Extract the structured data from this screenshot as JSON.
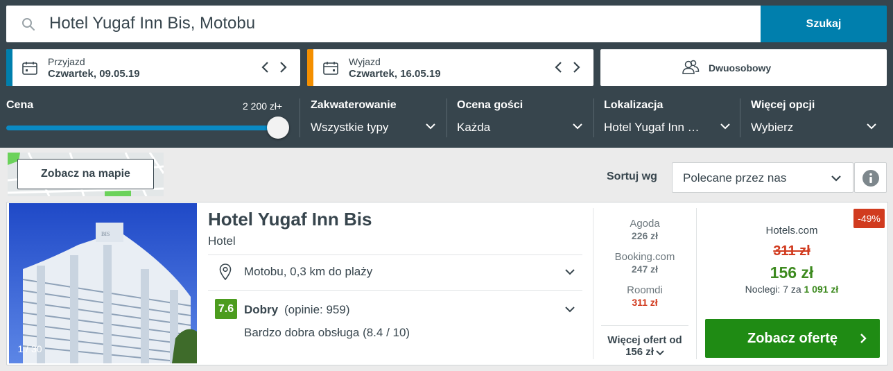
{
  "search": {
    "query": "Hotel Yugaf Inn Bis, Motobu",
    "button": "Szukaj"
  },
  "checkin": {
    "label": "Przyjazd",
    "value": "Czwartek, 09.05.19",
    "accent": "#007fad"
  },
  "checkout": {
    "label": "Wyjazd",
    "value": "Czwartek, 16.05.19",
    "accent": "#f48f00"
  },
  "room": {
    "label": "Dwuosobowy",
    "icon": "guests-icon"
  },
  "filters": {
    "price": {
      "title": "Cena",
      "max_label": "2 200 zł+",
      "slider_fraction": 1.0
    },
    "accommodation": {
      "title": "Zakwaterowanie",
      "value": "Wszystkie typy"
    },
    "rating": {
      "title": "Ocena gości",
      "value": "Każda"
    },
    "location": {
      "title": "Lokalizacja",
      "value": "Hotel Yugaf Inn …"
    },
    "more": {
      "title": "Więcej opcji",
      "value": "Wybierz"
    }
  },
  "toolbar": {
    "map_button": "Zobacz na mapie",
    "sort_label": "Sortuj wg",
    "sort_value": "Polecane przez nas"
  },
  "result": {
    "photo_counter": "1 / 30",
    "name": "Hotel Yugaf Inn Bis",
    "type": "Hotel",
    "location": "Motobu, 0,3 km do plaży",
    "rating_score": "7.6",
    "rating_word": "Dobry",
    "rating_count": "(opinie: 959)",
    "rating_detail": "Bardzo dobra obsługa (8.4 / 10)",
    "offers": [
      {
        "site": "Agoda",
        "price": "226 zł"
      },
      {
        "site": "Booking.com",
        "price": "247 zł"
      },
      {
        "site": "Roomdi",
        "price": "311 zł"
      }
    ],
    "more_offers_line1": "Więcej ofert od",
    "more_offers_line2": "156 zł",
    "discount": "-49%",
    "best_site": "Hotels.com",
    "old_price": "311 zł",
    "new_price": "156 zł",
    "nights_prefix": "Noclegi: 7 za",
    "nights_total": "1 091 zł",
    "cta": "Zobacz ofertę"
  },
  "colors": {
    "header_bg": "#37454d",
    "primary_blue": "#007fad",
    "green": "#1f8b14",
    "discount_red": "#d13b1f"
  }
}
